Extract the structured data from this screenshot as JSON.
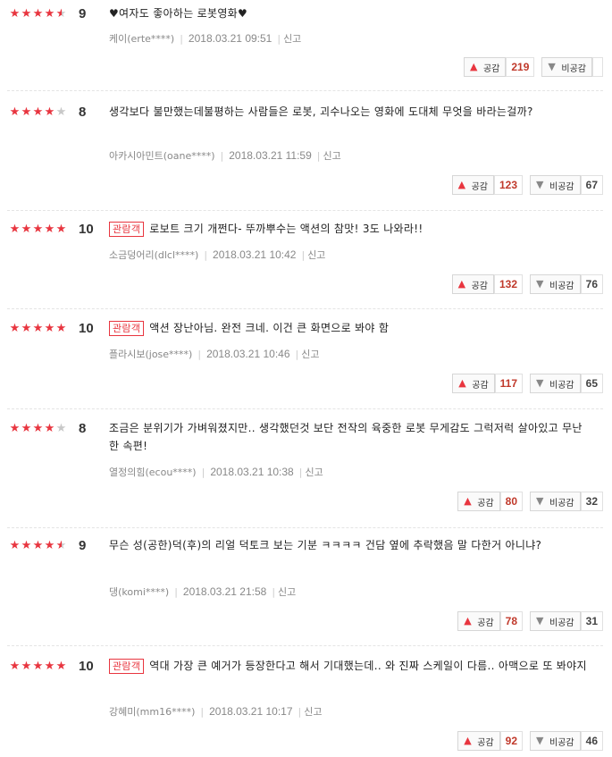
{
  "labels": {
    "like": "공감",
    "dislike": "비공감",
    "report": "신고",
    "badge": "관람객"
  },
  "icons": {
    "star": "star-icon",
    "like": "thumbs-up-icon",
    "dislike": "thumbs-down-icon"
  },
  "colors": {
    "star_on": "#e8353f",
    "star_off": "#c8c8c8",
    "badge": "#e8353f",
    "like_count": "#c0392b"
  },
  "reviews": [
    {
      "rating": 9,
      "stars": 4.5,
      "badge": false,
      "text": "♥여자도 좋아하는 로봇영화♥",
      "user": "케이(erte****)",
      "date": "2018.03.21 09:51",
      "likes": "219",
      "dislikes": ""
    },
    {
      "rating": 8,
      "stars": 4,
      "badge": false,
      "text": "생각보다 불만했는데불평하는 사람들은 로봇, 괴수나오는 영화에 도대체 무엇을 바라는걸까?",
      "user": "아카시아민트(oane****)",
      "date": "2018.03.21 11:59",
      "likes": "123",
      "dislikes": "67"
    },
    {
      "rating": 10,
      "stars": 5,
      "badge": true,
      "text": "로보트 크기 개쩐다- 뚜까뿌수는 액션의 참맛! 3도 나와라!!",
      "user": "소금덩어리(dlcl****)",
      "date": "2018.03.21 10:42",
      "likes": "132",
      "dislikes": "76"
    },
    {
      "rating": 10,
      "stars": 5,
      "badge": true,
      "text": "액션 장난아님. 완전 크네. 이건 큰 화면으로 봐야 함",
      "user": "플라시보(jose****)",
      "date": "2018.03.21 10:46",
      "likes": "117",
      "dislikes": "65"
    },
    {
      "rating": 8,
      "stars": 4,
      "badge": false,
      "text": "조금은 분위기가 가벼워졌지만.. 생각했던것 보단 전작의 육중한 로봇 무게감도 그럭저럭 살아있고 무난한 속편!",
      "user": "열정의힘(ecou****)",
      "date": "2018.03.21 10:38",
      "likes": "80",
      "dislikes": "32"
    },
    {
      "rating": 9,
      "stars": 4.5,
      "badge": false,
      "text": "무슨 성(공한)덕(후)의 리얼 덕토크 보는 기분 ㅋㅋㅋㅋ 건담 옆에 추락했음 말 다한거 아니냐?",
      "user": "댕(komi****)",
      "date": "2018.03.21 21:58",
      "likes": "78",
      "dislikes": "31"
    },
    {
      "rating": 10,
      "stars": 5,
      "badge": true,
      "text": "역대 가장 큰 예거가 등장한다고 해서 기대했는데.. 와 진짜 스케일이 다름.. 아맥으로 또 봐야지",
      "user": "강혜미(mm16****)",
      "date": "2018.03.21 10:17",
      "likes": "92",
      "dislikes": "46"
    }
  ]
}
